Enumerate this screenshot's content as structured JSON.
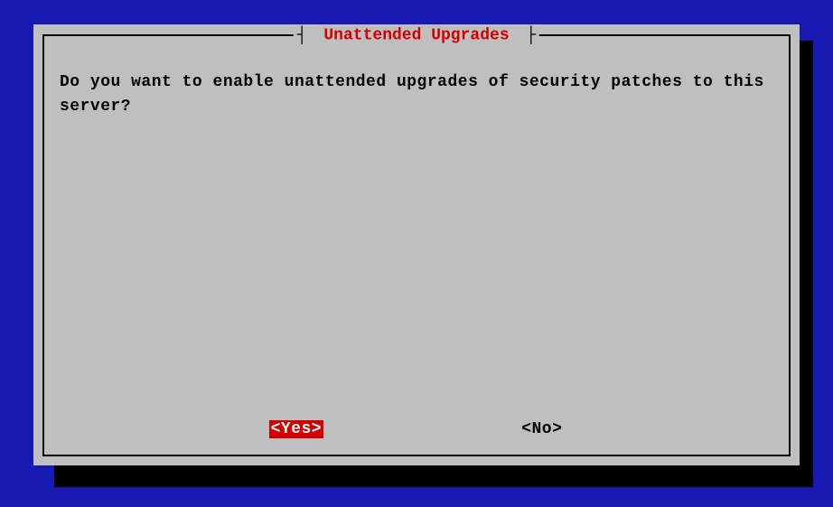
{
  "dialog": {
    "title": "Unattended Upgrades",
    "message": "Do you want to enable unattended upgrades of security patches to this server?",
    "buttons": {
      "yes": "<Yes>",
      "no": "<No>"
    },
    "colors": {
      "background": "#1818b2",
      "panel": "#bfbfbf",
      "accent": "#d40000"
    }
  }
}
